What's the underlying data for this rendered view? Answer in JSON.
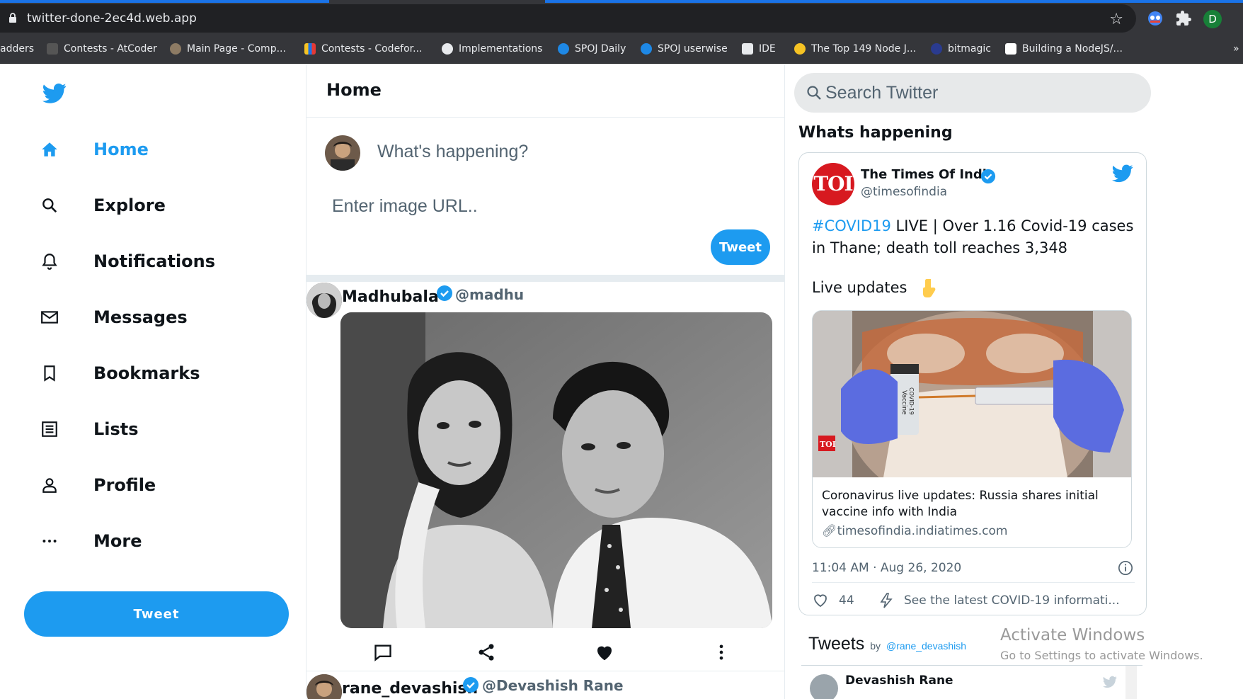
{
  "browser": {
    "url": "twitter-done-2ec4d.web.app",
    "profile_initial": "D",
    "bookmarks": [
      {
        "label": "adders"
      },
      {
        "label": "Contests - AtCoder"
      },
      {
        "label": "Main Page - Comp..."
      },
      {
        "label": "Contests - Codefor..."
      },
      {
        "label": "Implementations"
      },
      {
        "label": "SPOJ Daily"
      },
      {
        "label": "SPOJ userwise"
      },
      {
        "label": "IDE"
      },
      {
        "label": "The Top 149 Node J..."
      },
      {
        "label": "bitmagic"
      },
      {
        "label": "Building a NodeJS/..."
      }
    ],
    "overflow": "»"
  },
  "sidebar": {
    "items": [
      {
        "label": "Home",
        "icon": "home-icon"
      },
      {
        "label": "Explore",
        "icon": "search-icon"
      },
      {
        "label": "Notifications",
        "icon": "bell-icon"
      },
      {
        "label": "Messages",
        "icon": "mail-icon"
      },
      {
        "label": "Bookmarks",
        "icon": "bookmark-icon"
      },
      {
        "label": "Lists",
        "icon": "list-icon"
      },
      {
        "label": "Profile",
        "icon": "person-icon"
      },
      {
        "label": "More",
        "icon": "more-icon"
      }
    ],
    "tweet_button": "Tweet"
  },
  "feed": {
    "title": "Home",
    "compose_placeholder": "What's happening?",
    "image_url_placeholder": "Enter image URL..",
    "tweet_button": "Tweet",
    "posts": [
      {
        "name": "Madhubala",
        "handle": "@madhu"
      },
      {
        "name": "rane_devashish",
        "handle": "@Devashish Rane"
      }
    ]
  },
  "right": {
    "search_placeholder": "Search Twitter",
    "section_title": "Whats happening",
    "embed": {
      "logo_text": "TOI",
      "name": "The Times Of India",
      "handle": "@timesofindia",
      "hashtag": "#COVID19",
      "text": " LIVE | Over 1.16 Covid-19 cases in Thane; death toll reaches 3,348",
      "live": "Live updates",
      "card_title": "Coronavirus live updates: Russia shares initial vaccine info with India",
      "card_link": "timesofindia.indiatimes.com",
      "time": "11:04 AM · Aug 26, 2020",
      "likes": "44",
      "more": "See the latest COVID-19 informati...",
      "vial_label_1": "Vaccine",
      "vial_label_2": "COVID-19",
      "card_logo": "TOI"
    },
    "tweets_title": "Tweets",
    "tweets_by": "by",
    "tweets_handle": "@rane_devashish",
    "tweets_first_name": "Devashish Rane"
  },
  "watermark": {
    "line1": "Activate Windows",
    "line2": "Go to Settings to activate Windows."
  },
  "colors": {
    "accent": "#1d9bf0",
    "chrome": "#35363a",
    "toi_red": "#d71920"
  }
}
